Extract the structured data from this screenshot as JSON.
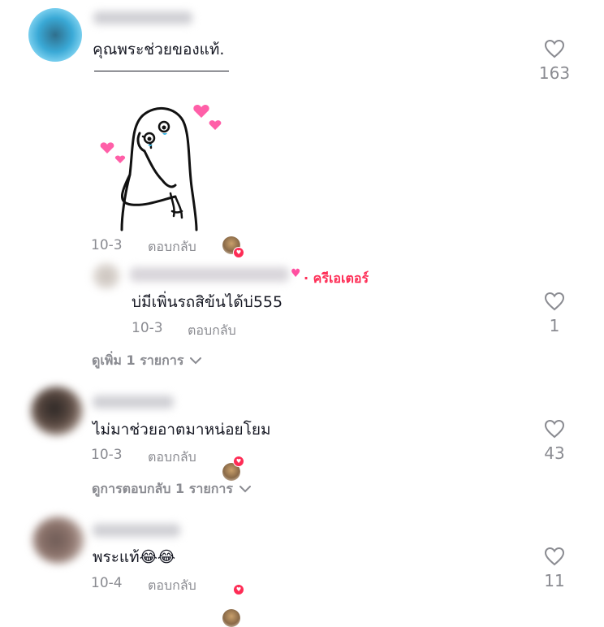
{
  "comments": [
    {
      "text": "คุณพระช่วยของแท้.",
      "date": "10-3",
      "reply_label": "ตอบกลับ",
      "like_count": "163"
    },
    {
      "creator_label": "· ครีเอเตอร์",
      "text": "บ่มีเพิ่นรถสิข้นได้บ่555",
      "date": "10-3",
      "reply_label": "ตอบกลับ",
      "like_count": "1"
    },
    {
      "text": "ไม่มาช่วยอาตมาหน่อยโยม",
      "date": "10-3",
      "reply_label": "ตอบกลับ",
      "like_count": "43"
    },
    {
      "text": "พระแท้😂😂",
      "date": "10-4",
      "reply_label": "ตอบกลับ",
      "like_count": "11"
    }
  ],
  "see_more_1": "ดูเพิ่ม 1 รายการ",
  "see_more_2": "ดูการตอบกลับ 1 รายการ",
  "icons": {
    "like": "heart-outline-icon",
    "expand": "chevron-down-icon",
    "sticker": "shy-ghost-sticker"
  },
  "colors": {
    "accent": "#fe2c55",
    "meta": "#8a8b91",
    "text": "#161823"
  }
}
